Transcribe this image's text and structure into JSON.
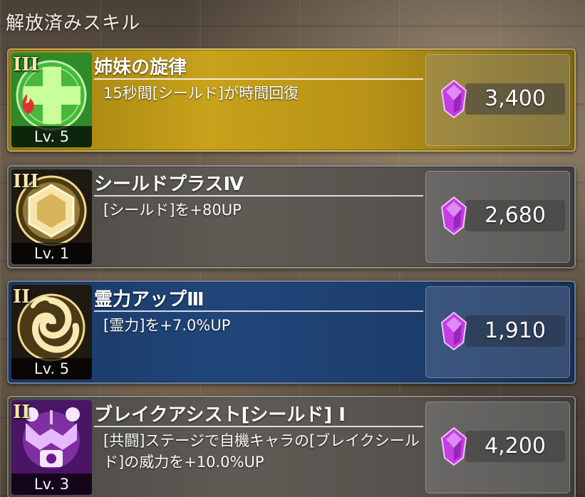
{
  "header": {
    "title": "解放済みスキル"
  },
  "skills": [
    {
      "rank": "III",
      "level": "Lv. 5",
      "name": "姉妹の旋律",
      "description": "15秒間[シールド]が時間回復",
      "cost": "3,400",
      "style": "gold",
      "icon": "green-cross-heal-icon"
    },
    {
      "rank": "III",
      "level": "Lv. 1",
      "name": "シールドプラスⅣ",
      "description": "[シールド]を+80UP",
      "cost": "2,680",
      "style": "gray",
      "icon": "hexagon-shield-icon"
    },
    {
      "rank": "II",
      "level": "Lv. 5",
      "name": "霊力アップⅢ",
      "description": "[霊力]を+7.0%UP",
      "cost": "1,910",
      "style": "blue",
      "icon": "spirit-swirl-icon"
    },
    {
      "rank": "II",
      "level": "Lv. 3",
      "name": "ブレイクアシスト[シールド] Ⅰ",
      "description": "[共闘]ステージで自機キャラの[ブレイクシールド]の威力を+10.0%UP",
      "cost": "4,200",
      "style": "gray",
      "icon": "break-assist-icon"
    }
  ],
  "currency_icon": "purple-gem-icon",
  "colors": {
    "gem": "#c43fe0",
    "gold_card": "#c8a21a",
    "blue_card": "#20467a",
    "gray_card": "#5e5b55"
  }
}
